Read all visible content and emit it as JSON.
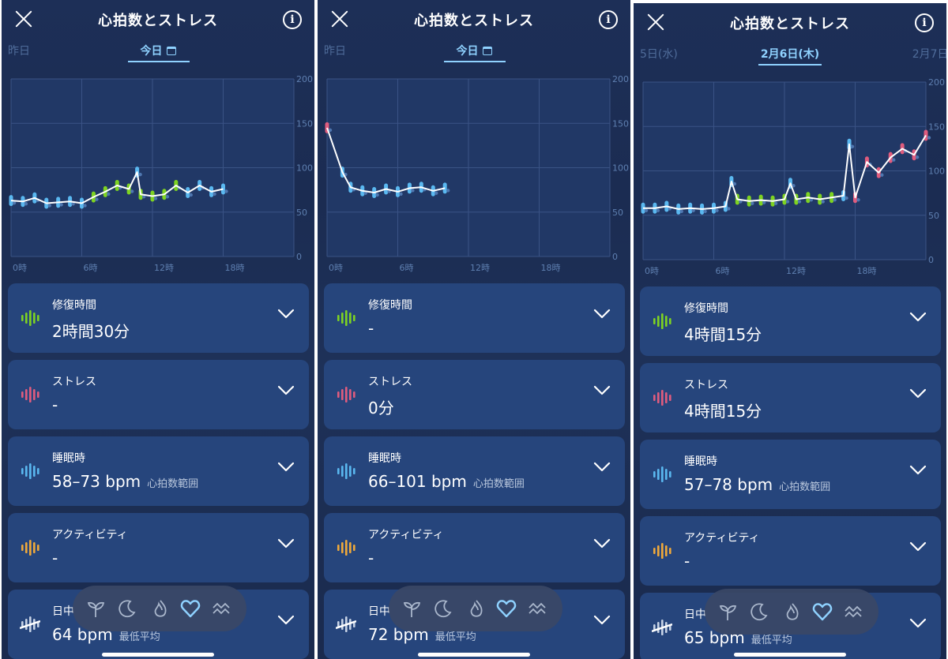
{
  "screens": [
    {
      "title": "心拍数とストレス",
      "date_prev": "昨日",
      "date_current": "今日",
      "date_next": "",
      "show_calendar": true,
      "y_ticks": [
        "200",
        "150",
        "100",
        "50",
        "0"
      ],
      "x_ticks": [
        "0時",
        "6時",
        "12時",
        "18時"
      ],
      "cards": [
        {
          "label": "修復時間",
          "value": "2時間30分",
          "sub": ""
        },
        {
          "label": "ストレス",
          "value": "-",
          "sub": ""
        },
        {
          "label": "睡眠時",
          "value": "58–73 bpm",
          "sub": "心拍数範囲"
        },
        {
          "label": "アクティビティ",
          "value": "-",
          "sub": ""
        },
        {
          "label": "日中",
          "value": "64 bpm",
          "sub": "最低平均"
        }
      ]
    },
    {
      "title": "心拍数とストレス",
      "date_prev": "昨日",
      "date_current": "今日",
      "date_next": "",
      "show_calendar": true,
      "y_ticks": [
        "200",
        "150",
        "100",
        "50",
        "0"
      ],
      "x_ticks": [
        "0時",
        "6時",
        "12時",
        "18時"
      ],
      "cards": [
        {
          "label": "修復時間",
          "value": "-",
          "sub": ""
        },
        {
          "label": "ストレス",
          "value": "0分",
          "sub": ""
        },
        {
          "label": "睡眠時",
          "value": "66–101 bpm",
          "sub": "心拍数範囲"
        },
        {
          "label": "アクティビティ",
          "value": "-",
          "sub": ""
        },
        {
          "label": "日中",
          "value": "72 bpm",
          "sub": "最低平均"
        }
      ]
    },
    {
      "title": "心拍数とストレス",
      "date_prev": "5日(水)",
      "date_current": "2月6日(木)",
      "date_next": "2月7日(",
      "show_calendar": false,
      "y_ticks": [
        "200",
        "150",
        "100",
        "50",
        "0"
      ],
      "x_ticks": [
        "0時",
        "6時",
        "12時",
        "18時"
      ],
      "cards": [
        {
          "label": "修復時間",
          "value": "4時間15分",
          "sub": ""
        },
        {
          "label": "ストレス",
          "value": "4時間15分",
          "sub": ""
        },
        {
          "label": "睡眠時",
          "value": "57–78 bpm",
          "sub": "心拍数範囲"
        },
        {
          "label": "アクティビティ",
          "value": "-",
          "sub": ""
        },
        {
          "label": "日中",
          "value": "65 bpm",
          "sub": "最低平均"
        }
      ]
    }
  ],
  "colors": {
    "recovery": "#7ed321",
    "stress": "#e05c7e",
    "sleep": "#5ab8f0",
    "activity": "#f0a93a",
    "daytime": "#c7d3e6",
    "card_bg": "#26457c",
    "accent": "#8fd2ff"
  },
  "card_icons": [
    "pulse-green-icon",
    "pulse-pink-icon",
    "pulse-blue-icon",
    "pulse-orange-icon",
    "pulse-white-icon"
  ],
  "nav_icons": [
    "sprout-icon",
    "moon-icon",
    "flame-icon",
    "heart-icon",
    "waves-icon"
  ],
  "nav_active": 3,
  "chart_data": [
    {
      "type": "line",
      "title": "",
      "xlabel": "",
      "ylabel": "",
      "x_unit": "hours",
      "ylim": [
        0,
        200
      ],
      "xlim": [
        0,
        24
      ],
      "x_tick_labels": [
        "0時",
        "6時",
        "12時",
        "18時"
      ],
      "y_tick_labels": [
        "0",
        "50",
        "100",
        "150",
        "200"
      ],
      "grid": true,
      "series": [
        {
          "values_x": [
            0,
            1,
            2,
            3,
            4,
            5,
            6,
            7,
            8,
            9,
            10,
            10.7,
            11,
            12,
            13,
            14,
            15,
            16,
            17,
            18
          ],
          "values_y": [
            63,
            62,
            66,
            60,
            61,
            62,
            60,
            67,
            73,
            80,
            76,
            95,
            70,
            68,
            70,
            80,
            72,
            80,
            73,
            76
          ]
        }
      ]
    },
    {
      "type": "line",
      "title": "",
      "xlabel": "",
      "ylabel": "",
      "x_unit": "hours",
      "ylim": [
        0,
        200
      ],
      "xlim": [
        0,
        24
      ],
      "x_tick_labels": [
        "0時",
        "6時",
        "12時",
        "18時"
      ],
      "y_tick_labels": [
        "0",
        "50",
        "100",
        "150",
        "200"
      ],
      "grid": true,
      "series": [
        {
          "values_x": [
            0,
            1.3,
            2,
            3,
            4,
            5,
            6,
            7,
            8,
            9,
            10
          ],
          "values_y": [
            145,
            95,
            78,
            74,
            72,
            76,
            73,
            77,
            78,
            74,
            77
          ]
        }
      ]
    },
    {
      "type": "line",
      "title": "",
      "xlabel": "",
      "ylabel": "",
      "x_unit": "hours",
      "ylim": [
        0,
        200
      ],
      "xlim": [
        0,
        24
      ],
      "x_tick_labels": [
        "0時",
        "6時",
        "12時",
        "18時"
      ],
      "y_tick_labels": [
        "0",
        "50",
        "100",
        "150",
        "200"
      ],
      "grid": true,
      "series": [
        {
          "values_x": [
            0,
            1,
            2,
            3,
            4,
            5,
            6,
            7,
            7.5,
            8,
            9,
            10,
            11,
            12,
            12.5,
            13,
            14,
            15,
            16,
            17,
            17.5,
            18,
            19,
            20,
            21,
            22,
            23,
            24
          ],
          "values_y": [
            58,
            58,
            60,
            57,
            58,
            57,
            58,
            60,
            88,
            68,
            66,
            67,
            66,
            68,
            86,
            68,
            70,
            68,
            70,
            72,
            130,
            70,
            110,
            98,
            115,
            125,
            118,
            140
          ]
        }
      ]
    }
  ]
}
